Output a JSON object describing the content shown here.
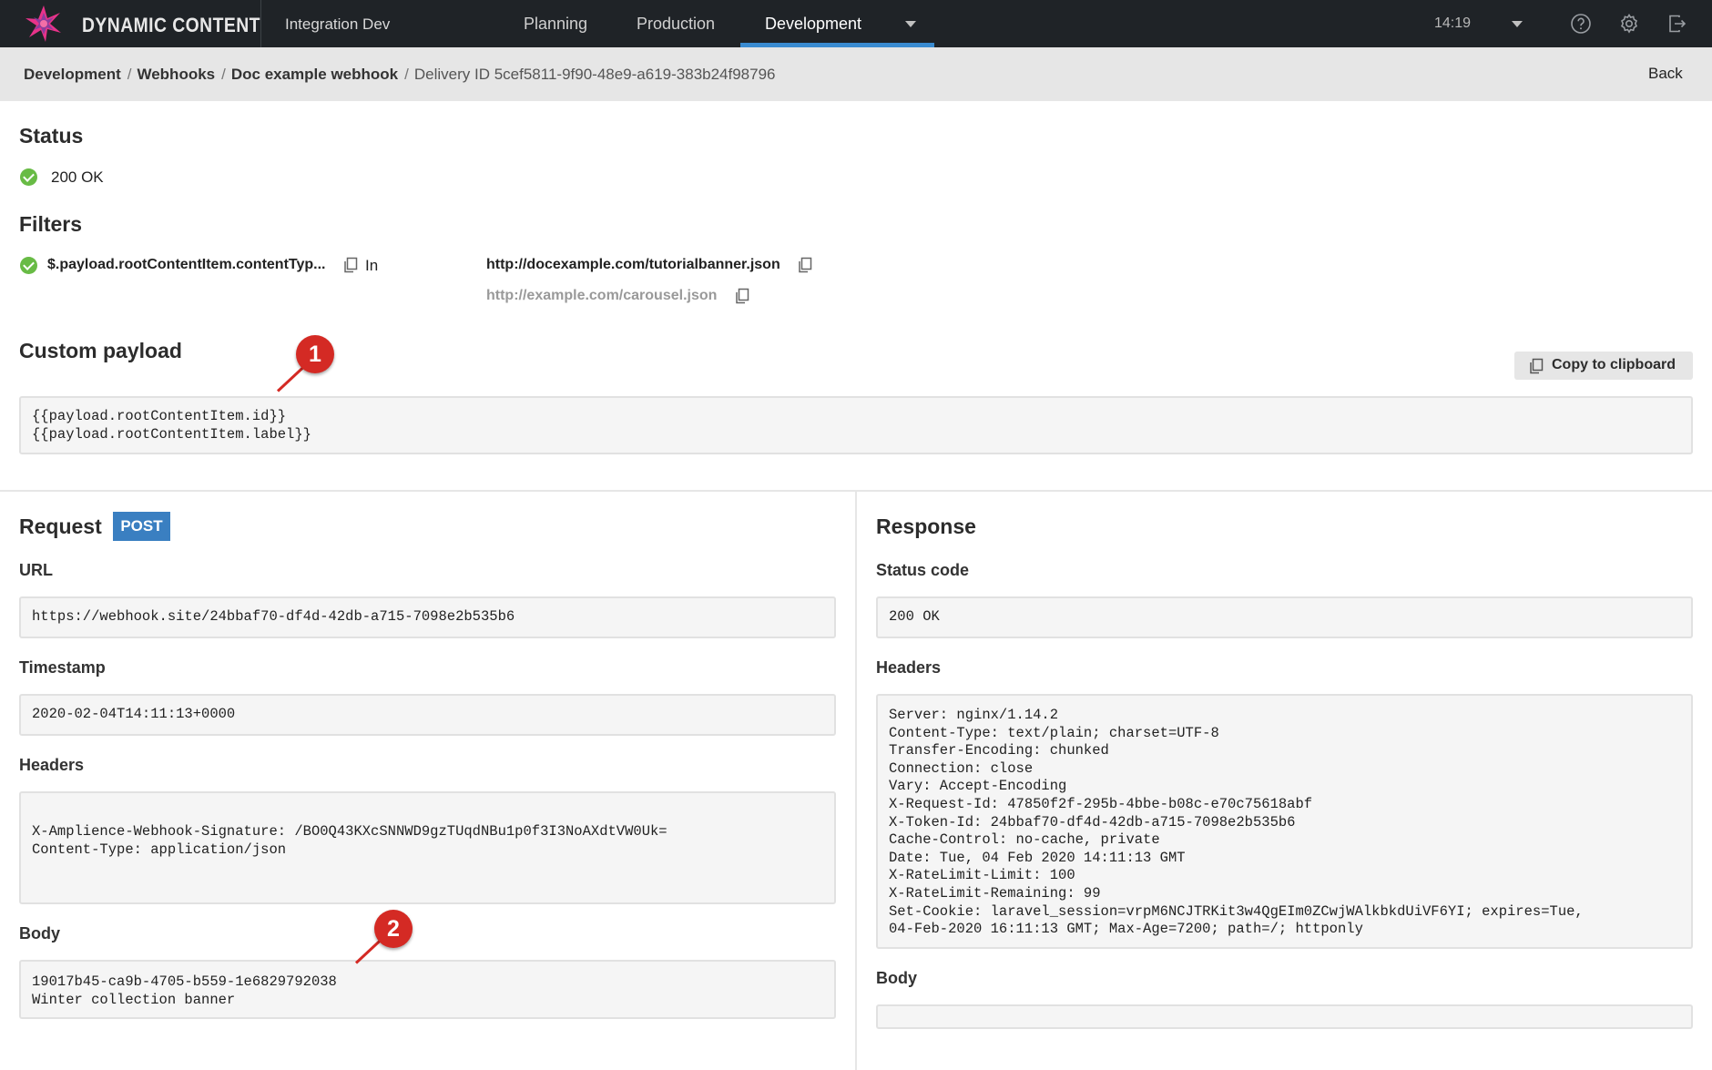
{
  "app": {
    "brand": "DYNAMIC CONTENT",
    "hub": "Integration Dev",
    "tabs": [
      {
        "label": "Planning",
        "active": false
      },
      {
        "label": "Production",
        "active": false
      },
      {
        "label": "Development",
        "active": true
      }
    ],
    "time": "14:19",
    "icons": [
      "help-icon",
      "settings-gear-icon",
      "logout-icon"
    ],
    "accent_color": "#3a8bd0"
  },
  "breadcrumb": {
    "items": [
      "Development",
      "Webhooks",
      "Doc example webhook"
    ],
    "current": "Delivery ID 5cef5811-9f90-48e9-a619-383b24f98796",
    "back": "Back"
  },
  "status": {
    "title": "Status",
    "value": "200 OK",
    "status_color": "#68bb45"
  },
  "filters": {
    "title": "Filters",
    "path": "$.payload.rootContentItem.contentTyp...",
    "operator": "In",
    "values": [
      "http://docexample.com/tutorialbanner.json",
      "http://example.com/carousel.json"
    ]
  },
  "custom_payload": {
    "title": "Custom payload",
    "copy_button": "Copy to clipboard",
    "content": "{{payload.rootContentItem.id}}\n{{payload.rootContentItem.label}}"
  },
  "request": {
    "title": "Request",
    "method": "POST",
    "url_label": "URL",
    "url": "https://webhook.site/24bbaf70-df4d-42db-a715-7098e2b535b6",
    "timestamp_label": "Timestamp",
    "timestamp": "2020-02-04T14:11:13+0000",
    "headers_label": "Headers",
    "headers": "X-Amplience-Webhook-Signature: /BO0Q43KXcSNNWD9gzTUqdNBu1p0f3I3NoAXdtVW0Uk=\nContent-Type: application/json",
    "body_label": "Body",
    "body": "19017b45-ca9b-4705-b559-1e6829792038\nWinter collection banner"
  },
  "response": {
    "title": "Response",
    "status_code_label": "Status code",
    "status_code": "200 OK",
    "headers_label": "Headers",
    "headers": "Server: nginx/1.14.2\nContent-Type: text/plain; charset=UTF-8\nTransfer-Encoding: chunked\nConnection: close\nVary: Accept-Encoding\nX-Request-Id: 47850f2f-295b-4bbe-b08c-e70c75618abf\nX-Token-Id: 24bbaf70-df4d-42db-a715-7098e2b535b6\nCache-Control: no-cache, private\nDate: Tue, 04 Feb 2020 14:11:13 GMT\nX-RateLimit-Limit: 100\nX-RateLimit-Remaining: 99\nSet-Cookie: laravel_session=vrpM6NCJTRKit3w4QgEIm0ZCwjWAlkbkdUiVF6YI; expires=Tue,\n04-Feb-2020 16:11:13 GMT; Max-Age=7200; path=/; httponly",
    "body_label": "Body",
    "body": ""
  },
  "annotations": {
    "marker_1": "1",
    "marker_2": "2",
    "marker_color": "#d42a24"
  }
}
